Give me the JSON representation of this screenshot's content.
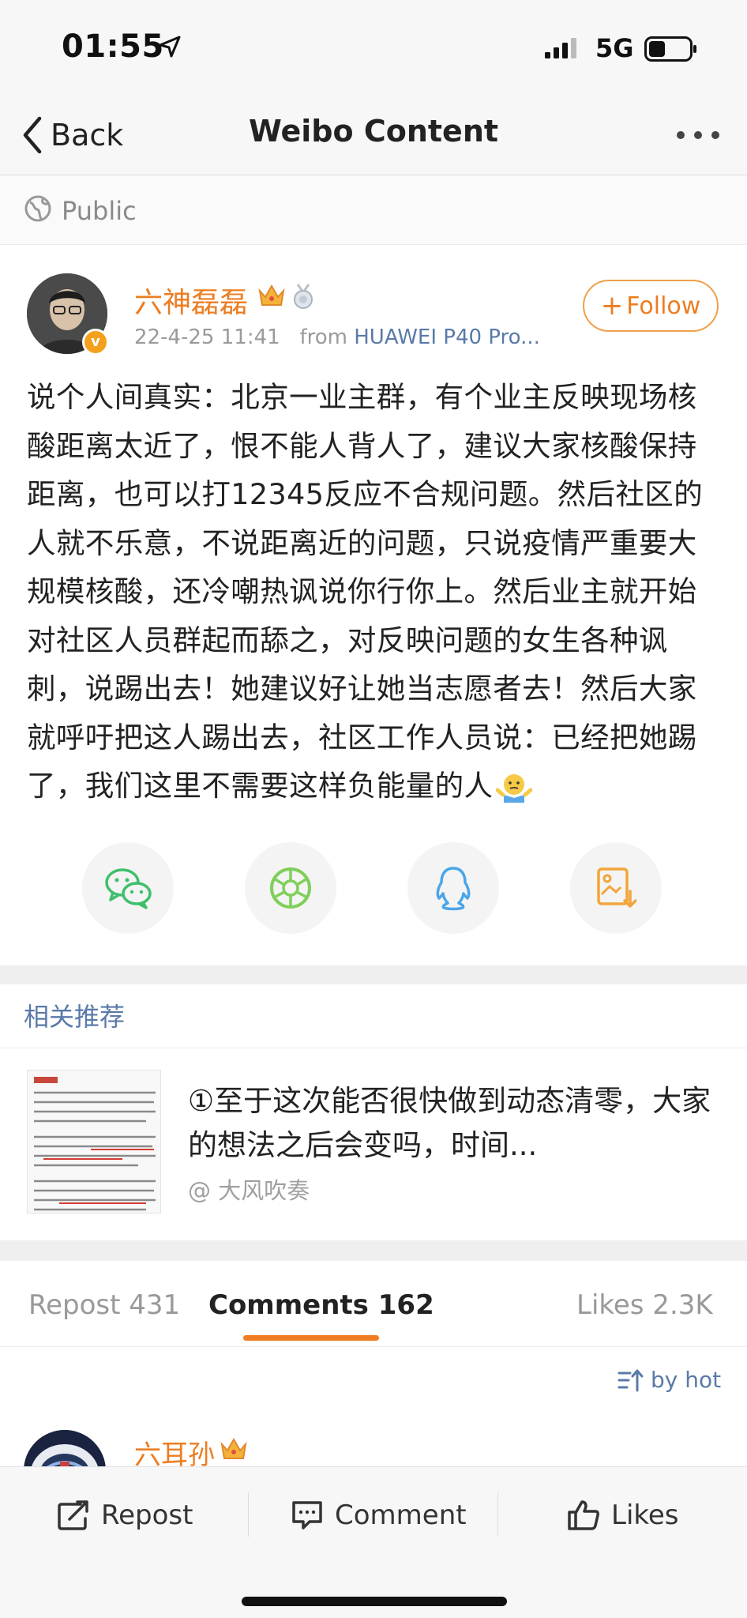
{
  "status_bar": {
    "time": "01:55",
    "network": "5G"
  },
  "nav": {
    "back_label": "Back",
    "title": "Weibo Content"
  },
  "visibility": {
    "label": "Public"
  },
  "post": {
    "author": "六神磊磊",
    "timestamp": "22-4-25 11:41",
    "from_label": "from",
    "source": "HUAWEI P40 Pro...",
    "follow_label": "Follow",
    "text": "说个人间真实：北京一业主群，有个业主反映现场核酸距离太近了，恨不能人背人了，建议大家核酸保持距离，也可以打12345反应不合规问题。然后社区的人就不乐意，不说距离近的问题，只说疫情严重要大规模核酸，还冷嘲热讽说你行你上。然后业主就开始对社区人员群起而舔之，对反映问题的女生各种讽刺，说踢出去！她建议好让她当志愿者去！然后大家就呼吁把这人踢出去，社区工作人员说：已经把她踢了，我们这里不需要这样负能量的人"
  },
  "share_icons": [
    "wechat-icon",
    "moments-icon",
    "qq-icon",
    "save-image-icon"
  ],
  "related": {
    "heading": "相关推荐",
    "item": {
      "title": "①至于这次能否很快做到动态清零，大家的想法之后会变吗，时间...",
      "author": "@ 大风吹奏"
    }
  },
  "tabs": [
    {
      "label": "Repost 431"
    },
    {
      "label": "Comments 162",
      "active": true
    },
    {
      "label": "Likes 2.3K"
    }
  ],
  "sort_label": "by hot",
  "comment": {
    "author": "六耳孙"
  },
  "bottom_bar": {
    "repost": "Repost",
    "comment": "Comment",
    "likes": "Likes"
  },
  "colors": {
    "accent_orange": "#ec7d22",
    "link_blue": "#5a7aa8",
    "background_gray": "#f7f7f7"
  }
}
